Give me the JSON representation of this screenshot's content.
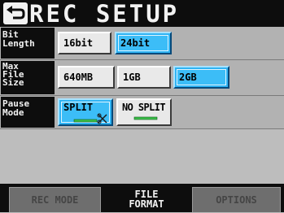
{
  "header": {
    "title": "REC SETUP",
    "back_icon": "return-arrow-icon"
  },
  "settings": [
    {
      "label": "Bit\nLength",
      "options": [
        "16bit",
        "24bit"
      ],
      "selected": "24bit"
    },
    {
      "label": "Max\nFile\nSize",
      "options": [
        "640MB",
        "1GB",
        "2GB"
      ],
      "selected": "2GB"
    },
    {
      "label": "Pause\nMode",
      "options": [
        "SPLIT",
        "NO SPLIT"
      ],
      "selected": "SPLIT"
    }
  ],
  "tabs": [
    {
      "label": "REC MODE",
      "active": false
    },
    {
      "label": "FILE FORMAT",
      "line1": "FILE",
      "line2": "FORMAT",
      "active": true
    },
    {
      "label": "OPTIONS",
      "active": false
    }
  ],
  "colors": {
    "selected": "#2fb4f4",
    "title_bg": "#0d0d0d",
    "icon_green": "#3cc04a"
  }
}
